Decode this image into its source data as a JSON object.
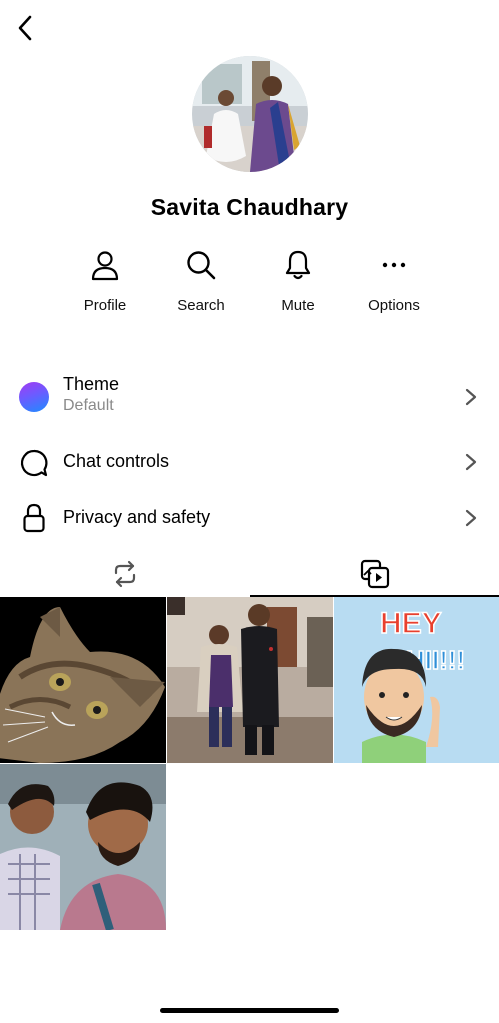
{
  "header": {
    "back_icon": "chevron-left-icon",
    "avatar_alt": "Savita Chaudhary profile photo"
  },
  "profile": {
    "name": "Savita Chaudhary"
  },
  "actions": [
    {
      "label": "Profile",
      "icon": "person-icon"
    },
    {
      "label": "Search",
      "icon": "search-icon"
    },
    {
      "label": "Mute",
      "icon": "bell-icon"
    },
    {
      "label": "Options",
      "icon": "more-horizontal-icon"
    }
  ],
  "settings": {
    "theme": {
      "title": "Theme",
      "subtitle": "Default",
      "icon": "theme-gradient-dot"
    },
    "chat_controls": {
      "title": "Chat controls",
      "icon": "chat-bubble-icon"
    },
    "privacy": {
      "title": "Privacy and safety",
      "icon": "lock-icon"
    }
  },
  "media_tabs": [
    {
      "icon": "repeat-icon",
      "selected": false
    },
    {
      "icon": "media-gallery-icon",
      "selected": true
    }
  ],
  "media_grid": [
    {
      "description": "cat photo"
    },
    {
      "description": "two people standing indoors"
    },
    {
      "description": "HEY HII!!! avatar sticker",
      "text_line1": "HEY",
      "text_line2": "HII!!!"
    },
    {
      "description": "selfie of two young men"
    }
  ],
  "colors": {
    "accent_gradient_start": "#a33bf2",
    "accent_gradient_end": "#1e8cff",
    "subtitle_gray": "#8a8a8a"
  }
}
